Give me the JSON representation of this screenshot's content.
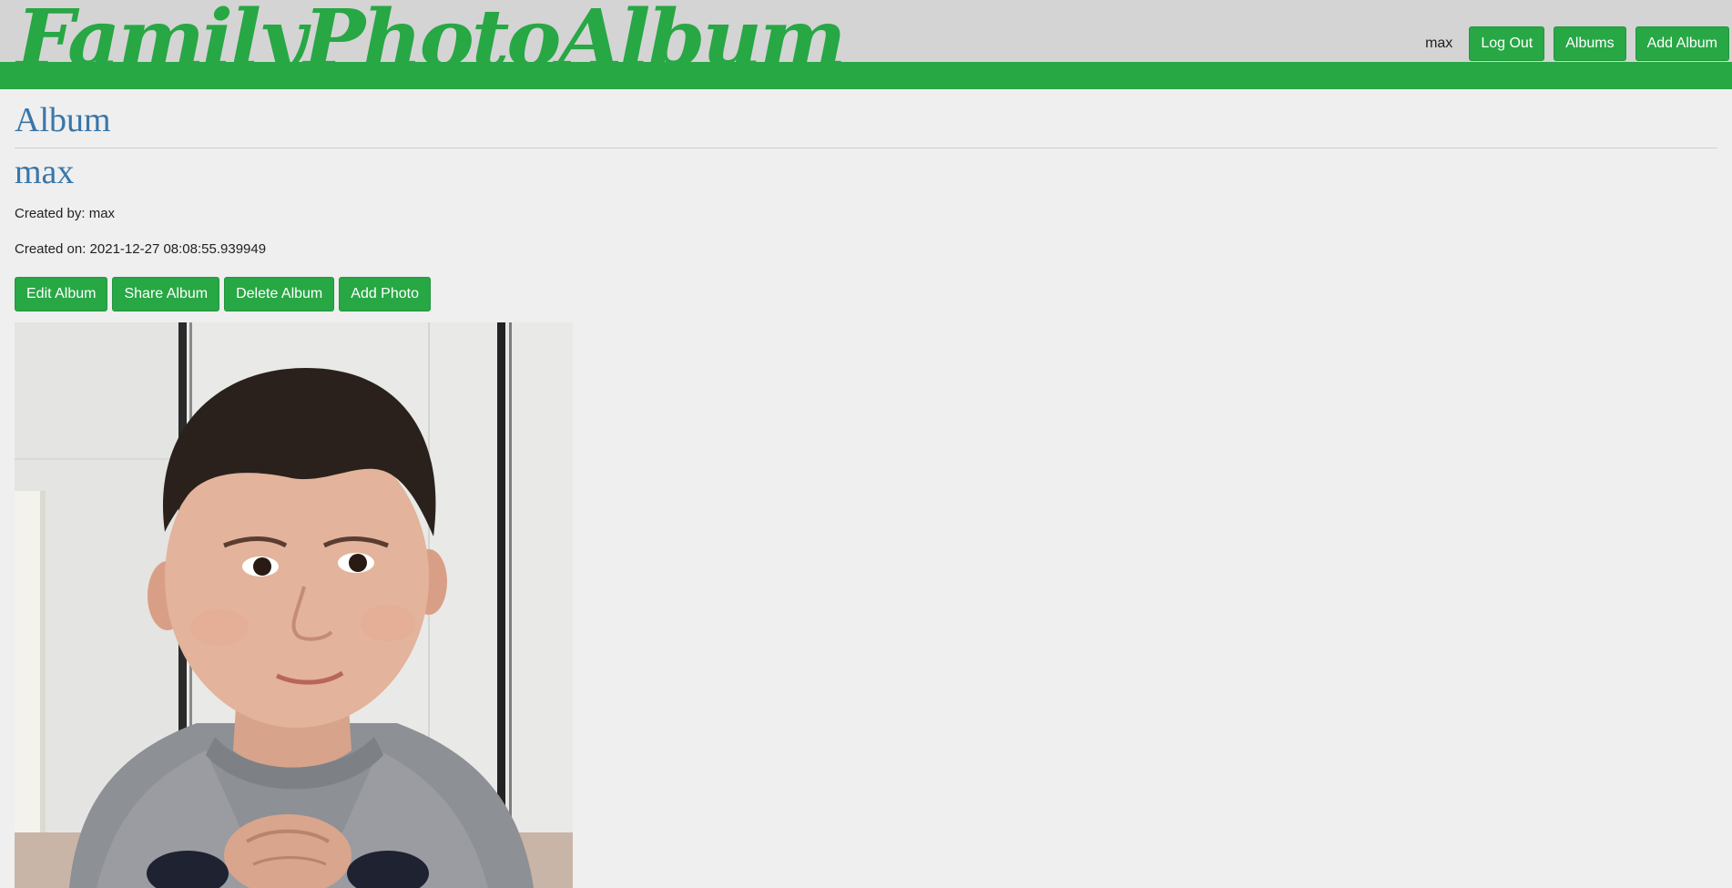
{
  "header": {
    "logo": "FamilyPhotoAlbum",
    "username": "max",
    "logout_label": "Log Out",
    "albums_label": "Albums",
    "add_album_label": "Add Album"
  },
  "main": {
    "title": "Album",
    "album_name": "max",
    "created_by": "Created by: max",
    "created_on": "Created on: 2021-12-27 08:08:55.939949",
    "actions": {
      "edit_label": "Edit Album",
      "share_label": "Share Album",
      "delete_label": "Delete Album",
      "add_photo_label": "Add Photo"
    }
  },
  "colors": {
    "accent": "#28a745",
    "title": "#3a76a8",
    "header_bg": "#d4d4d4",
    "page_bg": "#efefef"
  }
}
